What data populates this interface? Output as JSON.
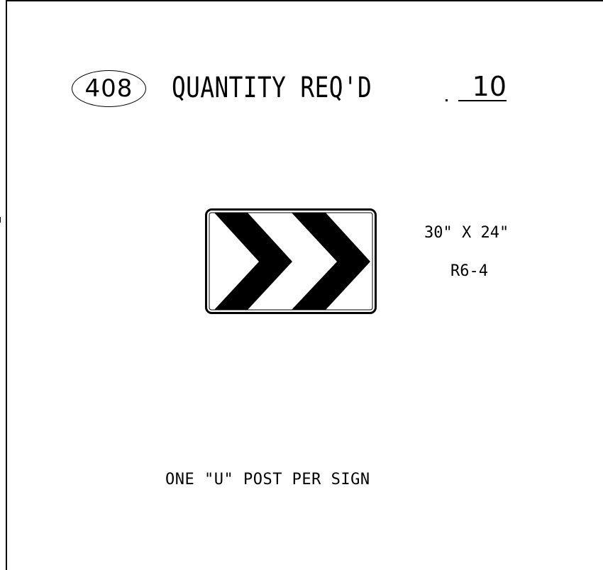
{
  "sheet": {
    "number": "408",
    "quantity_label": "QUANTITY REQ'D",
    "quantity_value": "10"
  },
  "sign": {
    "size": "30\" X 24\"",
    "code": "R6-4",
    "icon": "double-chevron-right-icon",
    "colors": {
      "background": "#ffffff",
      "legend": "#000000",
      "border": "#000000"
    }
  },
  "note": "ONE \"U\" POST PER SIGN"
}
